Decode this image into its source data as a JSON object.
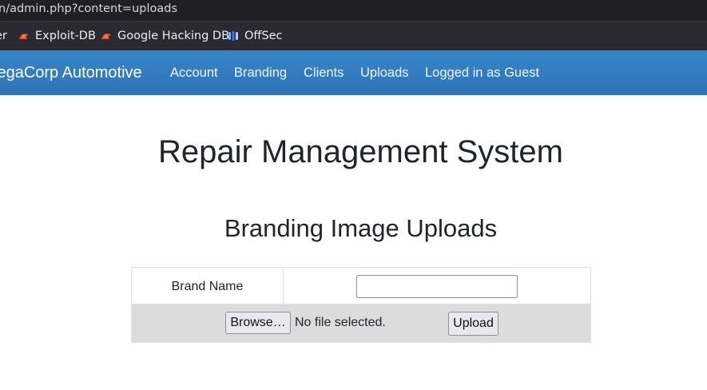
{
  "browser": {
    "url": "n/admin.php?content=uploads",
    "bookmarks": [
      {
        "label": "er",
        "icon": "none"
      },
      {
        "label": "Exploit-DB",
        "icon": "exploit-db-icon"
      },
      {
        "label": "Google Hacking DB",
        "icon": "exploit-db-icon"
      },
      {
        "label": "OffSec",
        "icon": "offsec-icon"
      }
    ]
  },
  "navbar": {
    "brand": "legaCorp Automotive",
    "items": [
      {
        "label": "Account"
      },
      {
        "label": "Branding"
      },
      {
        "label": "Clients"
      },
      {
        "label": "Uploads"
      },
      {
        "label": "Logged in as Guest"
      }
    ],
    "colors": {
      "background": "#2f78bb",
      "text": "#ffffff"
    }
  },
  "page": {
    "title": "Repair Management System",
    "subtitle": "Branding Image Uploads"
  },
  "form": {
    "brand_name_label": "Brand Name",
    "brand_name_value": "",
    "browse_label": "Browse…",
    "file_status": "No file selected.",
    "upload_label": "Upload"
  }
}
